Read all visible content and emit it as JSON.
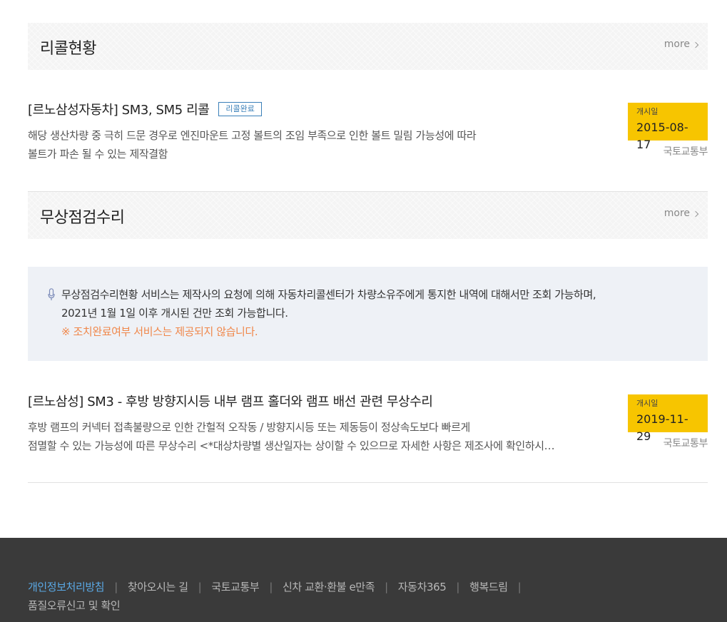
{
  "recall": {
    "section_title": "리콜현황",
    "more_label": "more",
    "items": [
      {
        "title": "[르노삼성자동차] SM3, SM5 리콜",
        "badge": "리콜완료",
        "desc_line1": "해당 생산차량 중 극히 드문 경우로 엔진마운트 고정 볼트의 조임 부족으로 인한 볼트 밀림 가능성에 따라",
        "desc_line2": "볼트가 파손 될 수 있는 제작결함",
        "date_label": "개시일",
        "date": "2015-08-17",
        "agency": "국토교통부"
      }
    ]
  },
  "free_repair": {
    "section_title": "무상점검수리",
    "more_label": "more",
    "notice_line1": "무상점검수리현황 서비스는 제작사의 요청에 의해 자동차리콜센터가 차량소유주에게 통지한 내역에 대해서만 조회 가능하며,",
    "notice_line2": "2021년 1월 1일 이후 개시된 건만 조회 가능합니다.",
    "notice_warn": "※ 조치완료여부 서비스는 제공되지 않습니다.",
    "items": [
      {
        "title": "[르노삼성] SM3 - 후방 방향지시등 내부 램프 홀더와 램프 배선 관련 무상수리",
        "desc_line1": "후방 램프의 커넥터 접촉불량으로 인한 간헐적 오작동 / 방향지시등 또는 제동등이 정상속도보다 빠르게",
        "desc_line2": "점멸할 수 있는 가능성에 따른 무상수리 <*대상차량별 생산일자는 상이할 수 있으므로 자세한 사항은 제조사에 확인하시기 바랍니다>",
        "date_label": "개시일",
        "date": "2019-11-29",
        "agency": "국토교통부"
      }
    ]
  },
  "footer": {
    "links": [
      "개인정보처리방침",
      "찾아오시는 길",
      "국토교통부",
      "신차 교환·환불 e만족",
      "자동차365",
      "행복드림",
      "품질오류신고 및 확인"
    ],
    "separator": "|"
  },
  "colors": {
    "date_box": "#f7c500",
    "badge": "#3a7fb8",
    "warn": "#f0874a",
    "footer_bg": "#3a3a3a",
    "footer_highlight": "#5aa9e6"
  }
}
